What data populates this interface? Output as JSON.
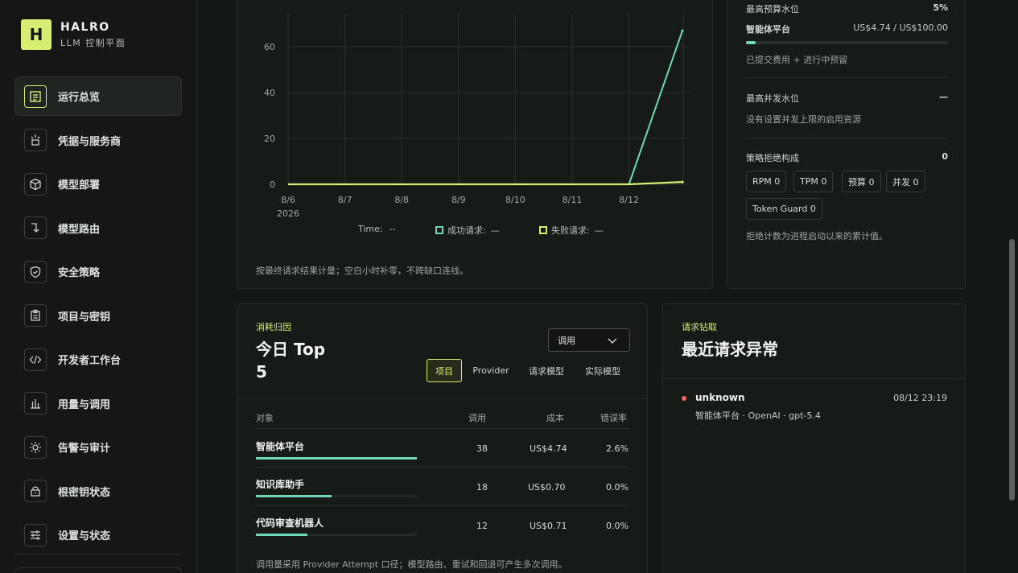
{
  "brand": {
    "logo_letter": "H",
    "name": "HALRO",
    "subtitle": "LLM 控制平面"
  },
  "sidebar": {
    "items": [
      {
        "label": "运行总览",
        "icon": "overview-icon",
        "active": true
      },
      {
        "label": "凭据与服务商",
        "icon": "credentials-icon",
        "active": false
      },
      {
        "label": "模型部署",
        "icon": "cube-icon",
        "active": false
      },
      {
        "label": "模型路由",
        "icon": "route-icon",
        "active": false
      },
      {
        "label": "安全策略",
        "icon": "shield-icon",
        "active": false
      },
      {
        "label": "项目与密钥",
        "icon": "clipboard-icon",
        "active": false
      },
      {
        "label": "开发者工作台",
        "icon": "code-icon",
        "active": false
      },
      {
        "label": "用量与调用",
        "icon": "bar-chart-icon",
        "active": false
      },
      {
        "label": "告警与审计",
        "icon": "alert-icon",
        "active": false
      },
      {
        "label": "根密钥状态",
        "icon": "lock-icon",
        "active": false
      },
      {
        "label": "设置与状态",
        "icon": "sliders-icon",
        "active": false
      }
    ]
  },
  "chart_data": {
    "type": "line",
    "x": [
      "8/6",
      "8/7",
      "8/8",
      "8/9",
      "8/10",
      "8/11",
      "8/12",
      "8/12 23:00"
    ],
    "year_label": "2026",
    "x_tick_labels": [
      "8/6",
      "8/7",
      "8/8",
      "8/9",
      "8/10",
      "8/11",
      "8/12"
    ],
    "y_ticks": [
      0,
      20,
      40,
      60
    ],
    "ylim": [
      0,
      70
    ],
    "series": [
      {
        "name": "成功请求",
        "color": "#6fd8b8",
        "values": [
          0,
          0,
          0,
          0,
          0,
          0,
          0,
          67
        ]
      },
      {
        "name": "失败请求",
        "color": "#d6ef72",
        "values": [
          0,
          0,
          0,
          0,
          0,
          0,
          0,
          1
        ]
      }
    ],
    "grid": true
  },
  "chart_legend": {
    "time_label": "Time:",
    "time_value": "--",
    "success_label": "成功请求:",
    "success_value": "—",
    "fail_label": "失败请求:",
    "fail_value": "—"
  },
  "chart_note": "按最终请求结果计量；空白小时补零，不跨缺口连线。",
  "budget": {
    "max_budget_label": "最高预算水位",
    "max_budget_pct": "5%",
    "platform_label": "智能体平台",
    "platform_value": "US$4.74 / US$100.00",
    "progress": 0.047,
    "platform_note": "已提交费用 + 进行中预留",
    "concurrency_label": "最高并发水位",
    "concurrency_value": "—",
    "concurrency_note": "没有设置并发上限的启用资源",
    "rejection_label": "策略拒绝构成",
    "rejection_value": "0",
    "chips": [
      "RPM 0",
      "TPM 0",
      "预算 0",
      "并发 0",
      "Token Guard 0"
    ],
    "rejection_note": "拒绝计数为进程启动以来的累计值。"
  },
  "top5": {
    "eyebrow": "消耗归因",
    "title_line1": "今日 Top",
    "title_line2": "5",
    "select_value": "调用",
    "segments": [
      "项目",
      "Provider",
      "请求模型",
      "实际模型"
    ],
    "active_segment": "项目",
    "headers": {
      "object": "对象",
      "calls": "调用",
      "cost": "成本",
      "error_rate": "错误率"
    },
    "rows": [
      {
        "name": "智能体平台",
        "calls": "38",
        "cost": "US$4.74",
        "error_rate": "2.6%",
        "share": 1.0
      },
      {
        "name": "知识库助手",
        "calls": "18",
        "cost": "US$0.70",
        "error_rate": "0.0%",
        "share": 0.47
      },
      {
        "name": "代码审查机器人",
        "calls": "12",
        "cost": "US$0.71",
        "error_rate": "0.0%",
        "share": 0.32
      }
    ],
    "note": "调用量采用 Provider Attempt 口径；模型路由、重试和回退可产生多次调用。"
  },
  "anomaly": {
    "eyebrow": "请求钻取",
    "title": "最近请求异常",
    "items": [
      {
        "status": "unknown",
        "time": "08/12 23:19",
        "detail": "智能体平台 · OpenAI · gpt-5.4"
      }
    ]
  }
}
